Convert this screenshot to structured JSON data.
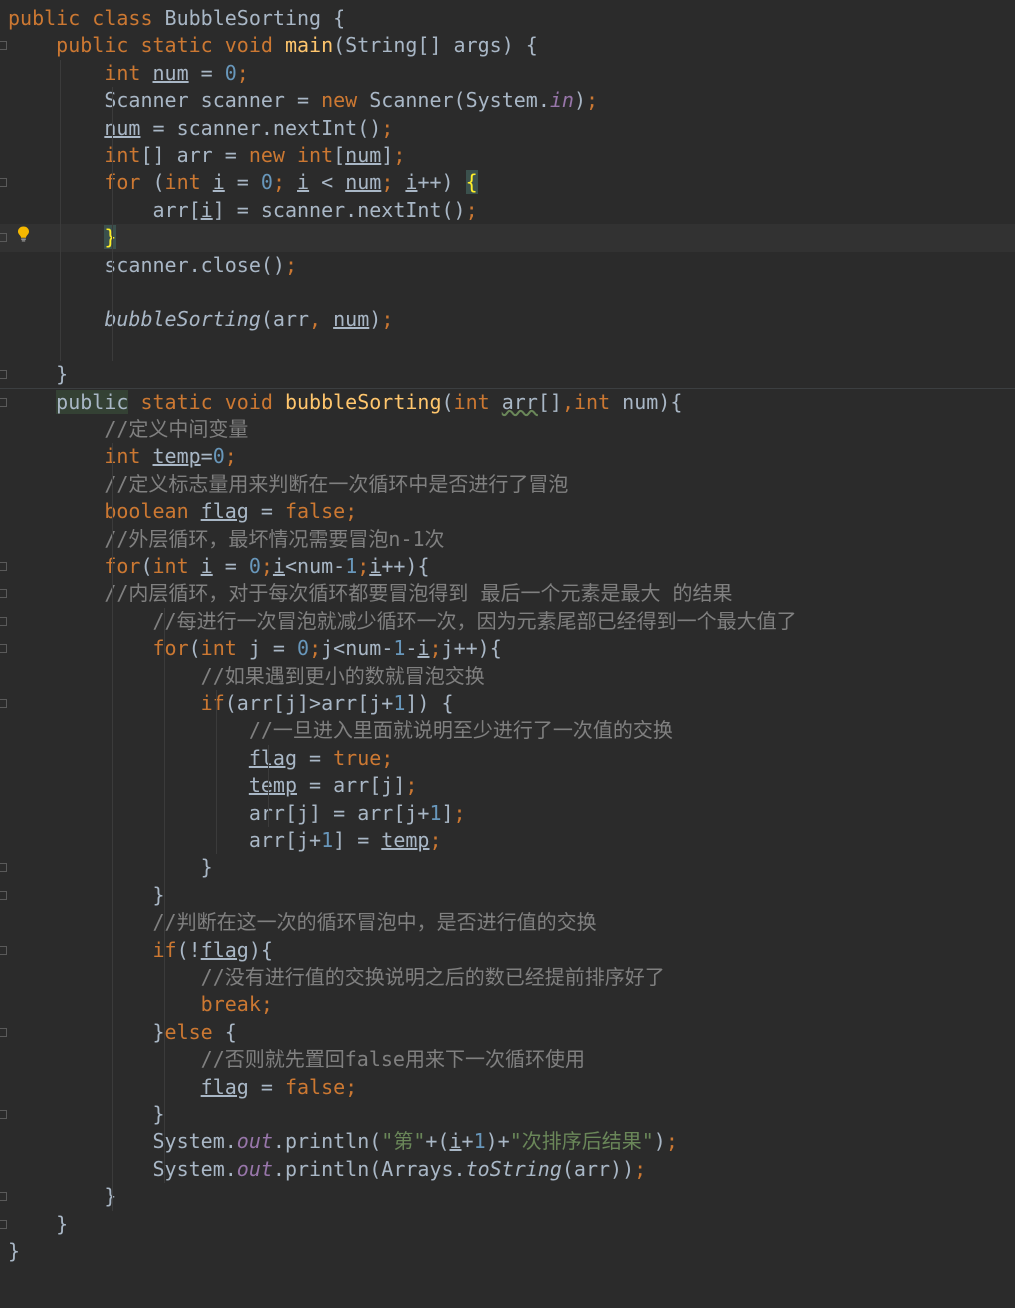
{
  "editor": {
    "language": "java",
    "colors": {
      "background": "#2b2b2b",
      "keyword": "#cc7832",
      "number": "#6897bb",
      "string": "#6a8759",
      "comment": "#808080",
      "method_decl": "#ffc66d",
      "static_field": "#9876aa",
      "default": "#a9b7c6"
    },
    "icons": [
      "fold-marker-icon",
      "lightbulb-icon"
    ],
    "lines": [
      [
        [
          "kw",
          "public class "
        ],
        [
          "p",
          "BubbleSorting {"
        ]
      ],
      [
        [
          "p",
          "    "
        ],
        [
          "kw",
          "public static void "
        ],
        [
          "fn",
          "main"
        ],
        [
          "p",
          "(String[] args) {"
        ]
      ],
      [
        [
          "p",
          "        "
        ],
        [
          "kw",
          "int "
        ],
        [
          "ul",
          "num"
        ],
        [
          "p",
          " = "
        ],
        [
          "num",
          "0"
        ],
        [
          "kw",
          ";"
        ]
      ],
      [
        [
          "p",
          "        Scanner scanner = "
        ],
        [
          "kw",
          "new "
        ],
        [
          "p",
          "Scanner(System."
        ],
        [
          "sf",
          "in"
        ],
        [
          "p",
          ")"
        ],
        [
          "kw",
          ";"
        ]
      ],
      [
        [
          "p",
          "        "
        ],
        [
          "ul",
          "num"
        ],
        [
          "p",
          " = scanner.nextInt()"
        ],
        [
          "kw",
          ";"
        ]
      ],
      [
        [
          "p",
          "        "
        ],
        [
          "kw",
          "int"
        ],
        [
          "p",
          "[] arr = "
        ],
        [
          "kw",
          "new int"
        ],
        [
          "p",
          "["
        ],
        [
          "ul",
          "num"
        ],
        [
          "p",
          "]"
        ],
        [
          "kw",
          ";"
        ]
      ],
      [
        [
          "p",
          "        "
        ],
        [
          "kw",
          "for "
        ],
        [
          "p",
          "("
        ],
        [
          "kw",
          "int "
        ],
        [
          "ul",
          "i"
        ],
        [
          "p",
          " = "
        ],
        [
          "num",
          "0"
        ],
        [
          "kw",
          "; "
        ],
        [
          "ul",
          "i"
        ],
        [
          "p",
          " < "
        ],
        [
          "ul",
          "num"
        ],
        [
          "kw",
          "; "
        ],
        [
          "ul",
          "i"
        ],
        [
          "p",
          "++) "
        ],
        [
          "bm",
          "{"
        ]
      ],
      [
        [
          "p",
          "            arr["
        ],
        [
          "ul",
          "i"
        ],
        [
          "p",
          "] = scanner.nextInt()"
        ],
        [
          "kw",
          ";"
        ]
      ],
      [
        [
          "p",
          "        "
        ],
        [
          "bm",
          "}"
        ]
      ],
      [
        [
          "p",
          "        scanner.close()"
        ],
        [
          "kw",
          ";"
        ]
      ],
      [
        [
          "p",
          ""
        ]
      ],
      [
        [
          "p",
          "        "
        ],
        [
          "sc",
          "bubbleSorting"
        ],
        [
          "p",
          "(arr"
        ],
        [
          "kw",
          ", "
        ],
        [
          "ul",
          "num"
        ],
        [
          "p",
          ")"
        ],
        [
          "kw",
          ";"
        ]
      ],
      [
        [
          "p",
          ""
        ]
      ],
      [
        [
          "p",
          "    }"
        ]
      ],
      [
        [
          "p",
          "    "
        ],
        [
          "pub",
          "public"
        ],
        [
          "kw",
          " static void "
        ],
        [
          "fn",
          "bubbleSorting"
        ],
        [
          "p",
          "("
        ],
        [
          "kw",
          "int "
        ],
        [
          "typo",
          "arr"
        ],
        [
          "p",
          "[]"
        ],
        [
          "kw",
          ","
        ],
        [
          "kw",
          "int "
        ],
        [
          "p",
          "num){"
        ]
      ],
      [
        [
          "p",
          "        "
        ],
        [
          "cmt",
          "//定义中间变量"
        ]
      ],
      [
        [
          "p",
          "        "
        ],
        [
          "kw",
          "int "
        ],
        [
          "ul",
          "temp"
        ],
        [
          "p",
          "="
        ],
        [
          "num",
          "0"
        ],
        [
          "kw",
          ";"
        ]
      ],
      [
        [
          "p",
          "        "
        ],
        [
          "cmt",
          "//定义标志量用来判断在一次循环中是否进行了冒泡"
        ]
      ],
      [
        [
          "p",
          "        "
        ],
        [
          "kw",
          "boolean "
        ],
        [
          "ul",
          "flag"
        ],
        [
          "p",
          " = "
        ],
        [
          "kw",
          "false;"
        ]
      ],
      [
        [
          "p",
          "        "
        ],
        [
          "cmt",
          "//外层循环，最坏情况需要冒泡n-1次"
        ]
      ],
      [
        [
          "p",
          "        "
        ],
        [
          "kw",
          "for"
        ],
        [
          "p",
          "("
        ],
        [
          "kw",
          "int "
        ],
        [
          "ul",
          "i"
        ],
        [
          "p",
          " = "
        ],
        [
          "num",
          "0"
        ],
        [
          "kw",
          ";"
        ],
        [
          "ul",
          "i"
        ],
        [
          "p",
          "<num-"
        ],
        [
          "num",
          "1"
        ],
        [
          "kw",
          ";"
        ],
        [
          "ul",
          "i"
        ],
        [
          "p",
          "++){"
        ]
      ],
      [
        [
          "p",
          "        "
        ],
        [
          "cmt",
          "//内层循环，对于每次循环都要冒泡得到 最后一个元素是最大 的结果"
        ]
      ],
      [
        [
          "p",
          "            "
        ],
        [
          "cmt",
          "//每进行一次冒泡就减少循环一次，因为元素尾部已经得到一个最大值了"
        ]
      ],
      [
        [
          "p",
          "            "
        ],
        [
          "kw",
          "for"
        ],
        [
          "p",
          "("
        ],
        [
          "kw",
          "int "
        ],
        [
          "p",
          "j = "
        ],
        [
          "num",
          "0"
        ],
        [
          "kw",
          ";"
        ],
        [
          "p",
          "j<num-"
        ],
        [
          "num",
          "1"
        ],
        [
          "p",
          "-"
        ],
        [
          "ul",
          "i"
        ],
        [
          "kw",
          ";"
        ],
        [
          "p",
          "j++){"
        ]
      ],
      [
        [
          "p",
          "                "
        ],
        [
          "cmt",
          "//如果遇到更小的数就冒泡交换"
        ]
      ],
      [
        [
          "p",
          "                "
        ],
        [
          "kw",
          "if"
        ],
        [
          "p",
          "(arr[j]>arr[j+"
        ],
        [
          "num",
          "1"
        ],
        [
          "p",
          "]) {"
        ]
      ],
      [
        [
          "p",
          "                    "
        ],
        [
          "cmt",
          "//一旦进入里面就说明至少进行了一次值的交换"
        ]
      ],
      [
        [
          "p",
          "                    "
        ],
        [
          "ul",
          "flag"
        ],
        [
          "p",
          " = "
        ],
        [
          "kw",
          "true;"
        ]
      ],
      [
        [
          "p",
          "                    "
        ],
        [
          "ul",
          "temp"
        ],
        [
          "p",
          " = arr[j]"
        ],
        [
          "kw",
          ";"
        ]
      ],
      [
        [
          "p",
          "                    arr[j] = arr[j+"
        ],
        [
          "num",
          "1"
        ],
        [
          "p",
          "]"
        ],
        [
          "kw",
          ";"
        ]
      ],
      [
        [
          "p",
          "                    arr[j+"
        ],
        [
          "num",
          "1"
        ],
        [
          "p",
          "] = "
        ],
        [
          "ul",
          "temp"
        ],
        [
          "kw",
          ";"
        ]
      ],
      [
        [
          "p",
          "                }"
        ]
      ],
      [
        [
          "p",
          "            }"
        ]
      ],
      [
        [
          "p",
          "            "
        ],
        [
          "cmt",
          "//判断在这一次的循环冒泡中，是否进行值的交换"
        ]
      ],
      [
        [
          "p",
          "            "
        ],
        [
          "kw",
          "if"
        ],
        [
          "p",
          "(!"
        ],
        [
          "ul",
          "flag"
        ],
        [
          "p",
          "){"
        ]
      ],
      [
        [
          "p",
          "                "
        ],
        [
          "cmt",
          "//没有进行值的交换说明之后的数已经提前排序好了"
        ]
      ],
      [
        [
          "p",
          "                "
        ],
        [
          "kw",
          "break;"
        ]
      ],
      [
        [
          "p",
          "            }"
        ],
        [
          "kw",
          "else "
        ],
        [
          "p",
          "{"
        ]
      ],
      [
        [
          "p",
          "                "
        ],
        [
          "cmt",
          "//否则就先置回false用来下一次循环使用"
        ]
      ],
      [
        [
          "p",
          "                "
        ],
        [
          "ul",
          "flag"
        ],
        [
          "p",
          " = "
        ],
        [
          "kw",
          "false;"
        ]
      ],
      [
        [
          "p",
          "            }"
        ]
      ],
      [
        [
          "p",
          "            System."
        ],
        [
          "sf",
          "out"
        ],
        [
          "p",
          ".println("
        ],
        [
          "str",
          "\"第\""
        ],
        [
          "p",
          "+("
        ],
        [
          "ul",
          "i"
        ],
        [
          "p",
          "+"
        ],
        [
          "num",
          "1"
        ],
        [
          "p",
          ")+"
        ],
        [
          "str",
          "\"次排序后结果\""
        ],
        [
          "p",
          ")"
        ],
        [
          "kw",
          ";"
        ]
      ],
      [
        [
          "p",
          "            System."
        ],
        [
          "sf",
          "out"
        ],
        [
          "p",
          ".println(Arrays."
        ],
        [
          "sc",
          "toString"
        ],
        [
          "p",
          "(arr))"
        ],
        [
          "kw",
          ";"
        ]
      ],
      [
        [
          "p",
          "        }"
        ]
      ],
      [
        [
          "p",
          "    }"
        ]
      ],
      [
        [
          "p",
          "}"
        ]
      ]
    ]
  }
}
